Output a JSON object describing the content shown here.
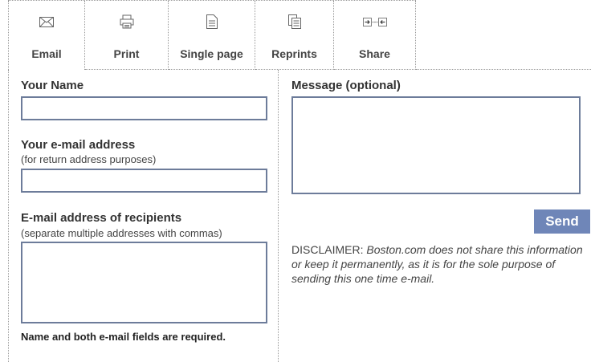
{
  "toolbar": {
    "items": [
      {
        "label": "Email",
        "icon": "envelope-icon"
      },
      {
        "label": "Print",
        "icon": "printer-icon"
      },
      {
        "label": "Single page",
        "icon": "document-icon"
      },
      {
        "label": "Reprints",
        "icon": "copies-icon"
      },
      {
        "label": "Share",
        "icon": "share-icon"
      }
    ]
  },
  "form": {
    "name_label": "Your Name",
    "email_label": "Your e-mail address",
    "email_hint": "(for return address purposes)",
    "recipients_label": "E-mail address of recipients",
    "recipients_hint": "(separate multiple addresses with commas)",
    "required_note": "Name and both e-mail fields are required.",
    "message_label": "Message (optional)",
    "send_label": "Send",
    "disclaimer_prefix": "DISCLAIMER: ",
    "disclaimer_text": "Boston.com does not share this information or keep it permanently, as it is for the sole purpose of sending this one time e-mail."
  },
  "colors": {
    "field_border": "#6d7c9a",
    "send_bg": "#6f86b8"
  }
}
